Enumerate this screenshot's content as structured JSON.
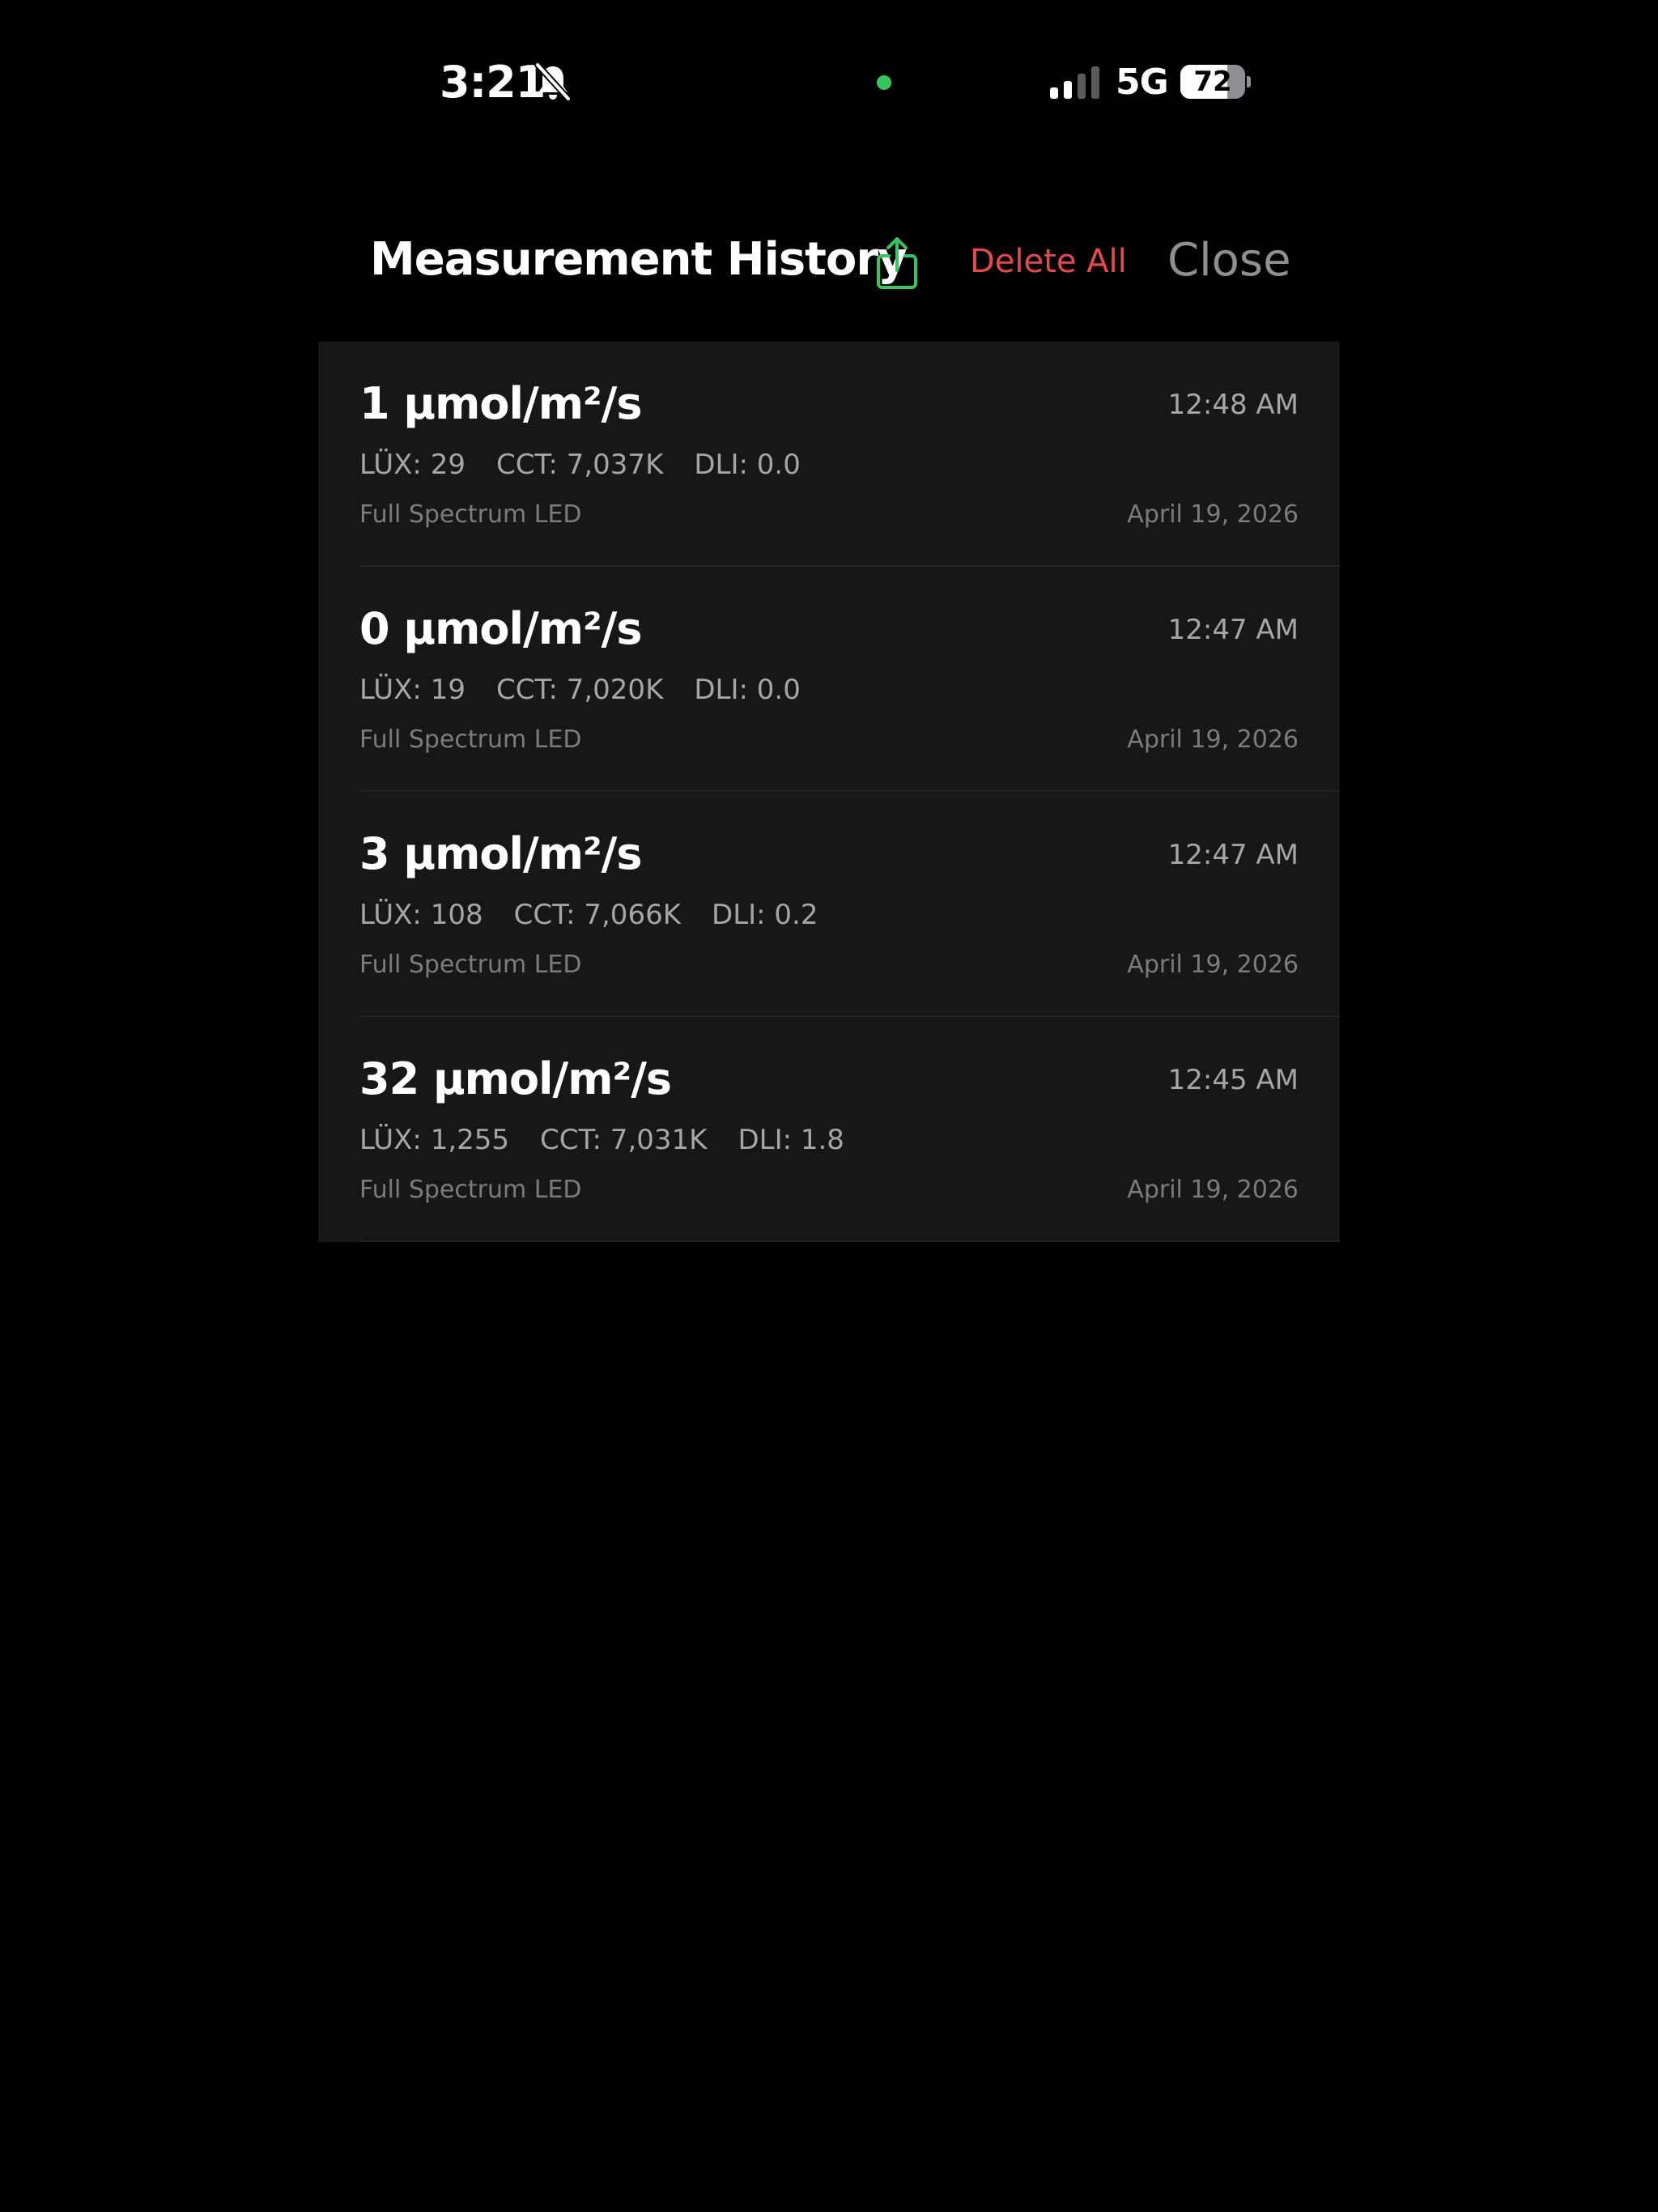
{
  "status_bar": {
    "time": "3:21",
    "silent_icon": "bell-slash-icon",
    "network": "5G",
    "battery_level": "72",
    "battery_fraction": 0.72,
    "privacy_dot_color": "#34c759"
  },
  "header": {
    "title": "Measurement History",
    "share_icon": "share-icon",
    "delete_all_label": "Delete All",
    "close_label": "Close"
  },
  "colors": {
    "accent_green": "#34c759",
    "destructive_red": "#e5484d",
    "secondary_gray": "#8e8e93",
    "row_background": "#171717"
  },
  "measurements": [
    {
      "ppfd": "1 µmol/m²/s",
      "time": "12:48 AM",
      "lux": "LÜX: 29",
      "cct": "CCT: 7,037K",
      "dli": "DLI: 0.0",
      "source": "Full Spectrum LED",
      "date": "April 19, 2026"
    },
    {
      "ppfd": "0 µmol/m²/s",
      "time": "12:47 AM",
      "lux": "LÜX: 19",
      "cct": "CCT: 7,020K",
      "dli": "DLI: 0.0",
      "source": "Full Spectrum LED",
      "date": "April 19, 2026"
    },
    {
      "ppfd": "3 µmol/m²/s",
      "time": "12:47 AM",
      "lux": "LÜX: 108",
      "cct": "CCT: 7,066K",
      "dli": "DLI: 0.2",
      "source": "Full Spectrum LED",
      "date": "April 19, 2026"
    },
    {
      "ppfd": "32 µmol/m²/s",
      "time": "12:45 AM",
      "lux": "LÜX: 1,255",
      "cct": "CCT: 7,031K",
      "dli": "DLI: 1.8",
      "source": "Full Spectrum LED",
      "date": "April 19, 2026"
    }
  ]
}
